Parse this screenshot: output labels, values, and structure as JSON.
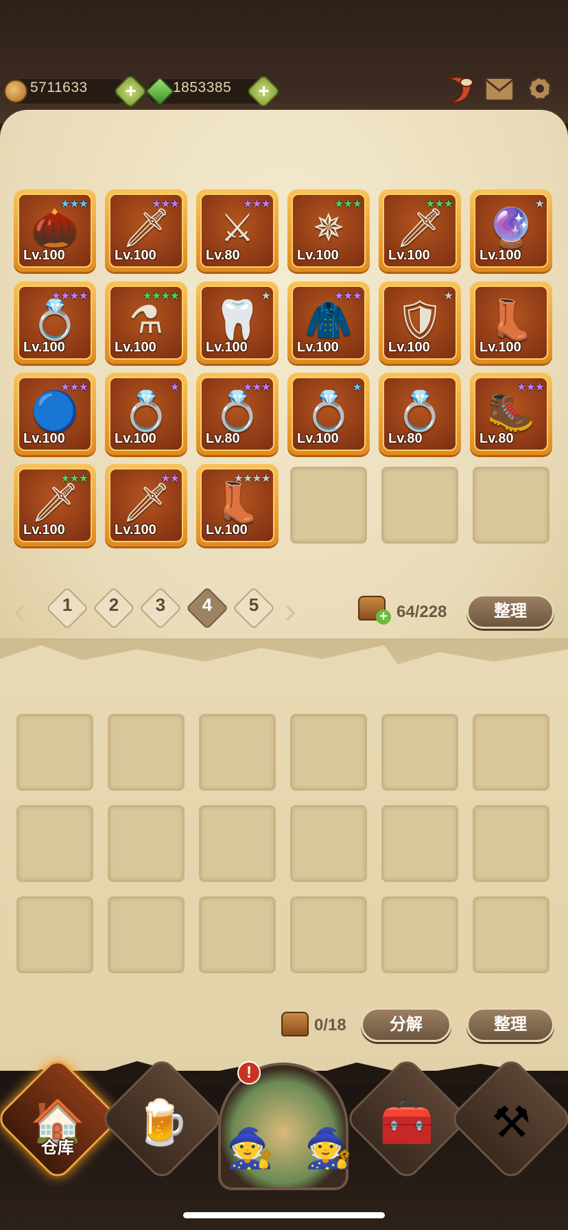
{
  "resources": {
    "gold": "5711633",
    "gems": "1853385",
    "plus": "+"
  },
  "header_icons": [
    "horn-icon",
    "mail-icon",
    "gear-icon"
  ],
  "items": [
    {
      "lv": "Lv.100",
      "stars": "★★★",
      "star_color": "#5cc8ff",
      "icon": "seed-icon",
      "glyph": "🌰"
    },
    {
      "lv": "Lv.100",
      "stars": "★★★",
      "star_color": "#c07cff",
      "icon": "dagger-icon",
      "glyph": "🗡"
    },
    {
      "lv": "Lv.80",
      "stars": "★★★",
      "star_color": "#c07cff",
      "icon": "claw-blade-icon",
      "glyph": "⚔"
    },
    {
      "lv": "Lv.100",
      "stars": "★★★",
      "star_color": "#4fd35a",
      "icon": "shuriken-icon",
      "glyph": "✵"
    },
    {
      "lv": "Lv.100",
      "stars": "★★★",
      "star_color": "#4fd35a",
      "icon": "kunai-icon",
      "glyph": "🗡"
    },
    {
      "lv": "Lv.100",
      "stars": "★",
      "star_color": "#c9c9c9",
      "icon": "orb-icon",
      "glyph": "🔮"
    },
    {
      "lv": "Lv.100",
      "stars": "★★★★",
      "star_color": "#c07cff",
      "icon": "ring-icon",
      "glyph": "💍"
    },
    {
      "lv": "Lv.100",
      "stars": "★★★★",
      "star_color": "#4fd35a",
      "icon": "potion-icon",
      "glyph": "⚗"
    },
    {
      "lv": "Lv.100",
      "stars": "★",
      "star_color": "#c9c9c9",
      "icon": "fang-necklace-icon",
      "glyph": "🦷"
    },
    {
      "lv": "Lv.100",
      "stars": "★★★",
      "star_color": "#c07cff",
      "icon": "cloak-icon",
      "glyph": "🧥"
    },
    {
      "lv": "Lv.100",
      "stars": "★",
      "star_color": "#c9c9c9",
      "icon": "armor-icon",
      "glyph": "🛡"
    },
    {
      "lv": "Lv.100",
      "stars": "",
      "star_color": "#c9c9c9",
      "icon": "boot-icon",
      "glyph": "👢"
    },
    {
      "lv": "Lv.100",
      "stars": "★★★",
      "star_color": "#c07cff",
      "icon": "amulet-icon",
      "glyph": "🔵"
    },
    {
      "lv": "Lv.100",
      "stars": "★",
      "star_color": "#c07cff",
      "icon": "ring-icon",
      "glyph": "💍"
    },
    {
      "lv": "Lv.80",
      "stars": "★★★",
      "star_color": "#c07cff",
      "icon": "gem-ring-icon",
      "glyph": "💍"
    },
    {
      "lv": "Lv.100",
      "stars": "★",
      "star_color": "#5cc8ff",
      "icon": "gem-ring-icon",
      "glyph": "💍"
    },
    {
      "lv": "Lv.80",
      "stars": "",
      "star_color": "#c07cff",
      "icon": "gem-ring-icon",
      "glyph": "💍"
    },
    {
      "lv": "Lv.80",
      "stars": "★★★",
      "star_color": "#c07cff",
      "icon": "armored-boot-icon",
      "glyph": "🥾"
    },
    {
      "lv": "Lv.100",
      "stars": "★★★",
      "star_color": "#4fd35a",
      "icon": "scimitar-icon",
      "glyph": "🗡"
    },
    {
      "lv": "Lv.100",
      "stars": "★★",
      "star_color": "#c07cff",
      "icon": "kunai-icon",
      "glyph": "🗡"
    },
    {
      "lv": "Lv.100",
      "stars": "★★★★",
      "star_color": "#c9c9c9",
      "icon": "boot-icon",
      "glyph": "👢"
    }
  ],
  "pager": {
    "pages": [
      "1",
      "2",
      "3",
      "4",
      "5"
    ],
    "active": 3,
    "prev": "‹",
    "next": "›"
  },
  "upper_panel": {
    "capacity": "64/228",
    "sort_label": "整理"
  },
  "lower_panel": {
    "capacity": "0/18",
    "decompose_label": "分解",
    "sort_label": "整理"
  },
  "nav": {
    "warehouse_label": "仓库",
    "alert": "!"
  }
}
